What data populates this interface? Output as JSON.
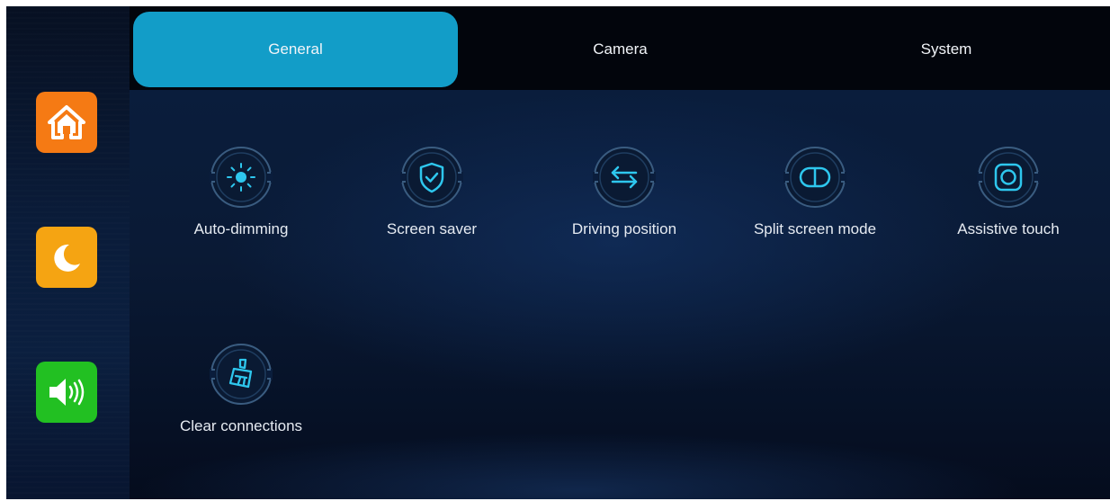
{
  "sidebar": {
    "buttons": [
      {
        "name": "home",
        "icon": "home-icon",
        "color": "#f57a14"
      },
      {
        "name": "night-mode",
        "icon": "moon-icon",
        "color": "#f5a412"
      },
      {
        "name": "volume",
        "icon": "speaker-icon",
        "color": "#22c022"
      }
    ]
  },
  "tabs": [
    {
      "label": "General",
      "active": true
    },
    {
      "label": "Camera",
      "active": false
    },
    {
      "label": "System",
      "active": false
    }
  ],
  "colors": {
    "accent": "#129dc8",
    "icon_stroke": "#2ec7ee",
    "ring": "#3a5c80"
  },
  "settings": [
    {
      "label": "Auto-dimming",
      "icon": "brightness-icon"
    },
    {
      "label": "Screen saver",
      "icon": "shield-check-icon"
    },
    {
      "label": "Driving position",
      "icon": "swap-arrows-icon"
    },
    {
      "label": "Split screen mode",
      "icon": "split-screen-icon"
    },
    {
      "label": "Assistive touch",
      "icon": "assistive-touch-icon"
    },
    {
      "label": "Clear connections",
      "icon": "broom-icon"
    }
  ]
}
